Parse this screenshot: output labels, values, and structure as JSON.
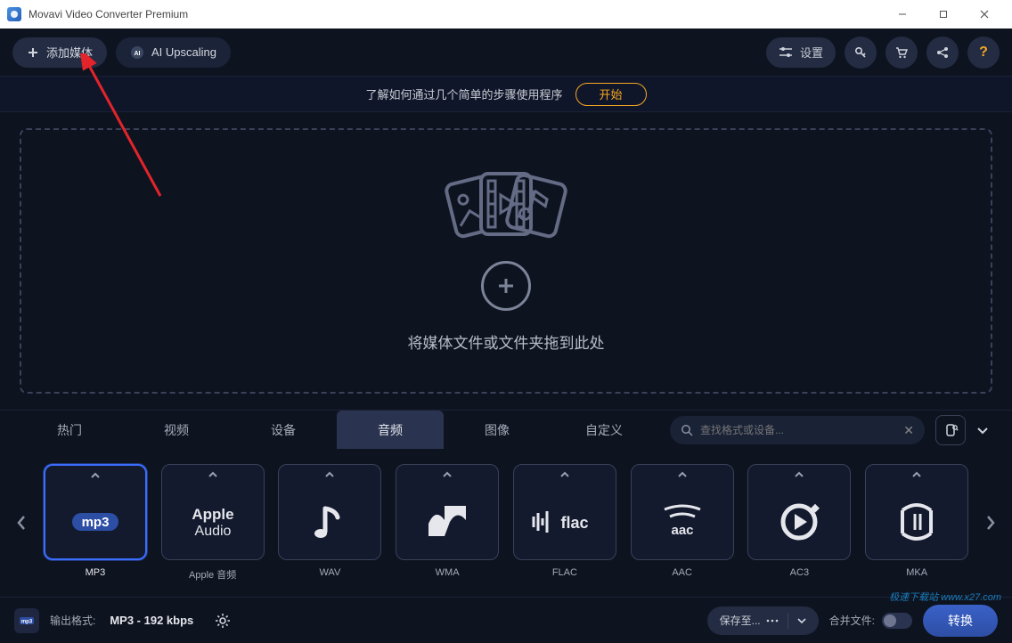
{
  "titlebar": {
    "title": "Movavi Video Converter Premium"
  },
  "toolbar": {
    "add_media_label": "添加媒体",
    "ai_upscaling_label": "AI Upscaling",
    "settings_label": "设置",
    "help_label": "?"
  },
  "banner": {
    "info_text": "了解如何通过几个简单的步骤使用程序",
    "start_label": "开始"
  },
  "dropzone": {
    "hint_text": "将媒体文件或文件夹拖到此处"
  },
  "tabs": {
    "items": [
      "热门",
      "视频",
      "设备",
      "音频",
      "图像",
      "自定义"
    ],
    "active_index": 3,
    "search_placeholder": "查找格式或设备..."
  },
  "formats": [
    {
      "label": "MP3",
      "display": "mp3",
      "selected": true
    },
    {
      "label": "Apple 音频",
      "display": "Apple Audio",
      "selected": false
    },
    {
      "label": "WAV",
      "display": "wav",
      "selected": false
    },
    {
      "label": "WMA",
      "display": "wma",
      "selected": false
    },
    {
      "label": "FLAC",
      "display": "flac",
      "selected": false
    },
    {
      "label": "AAC",
      "display": "aac",
      "selected": false
    },
    {
      "label": "AC3",
      "display": "ac3",
      "selected": false
    },
    {
      "label": "MKA",
      "display": "mka",
      "selected": false
    }
  ],
  "bottombar": {
    "output_format_label": "输出格式:",
    "output_format_value": "MP3 - 192 kbps",
    "save_to_label": "保存至...",
    "merge_label": "合并文件:",
    "convert_label": "转换"
  },
  "watermark": "极速下载站 www.x27.com"
}
